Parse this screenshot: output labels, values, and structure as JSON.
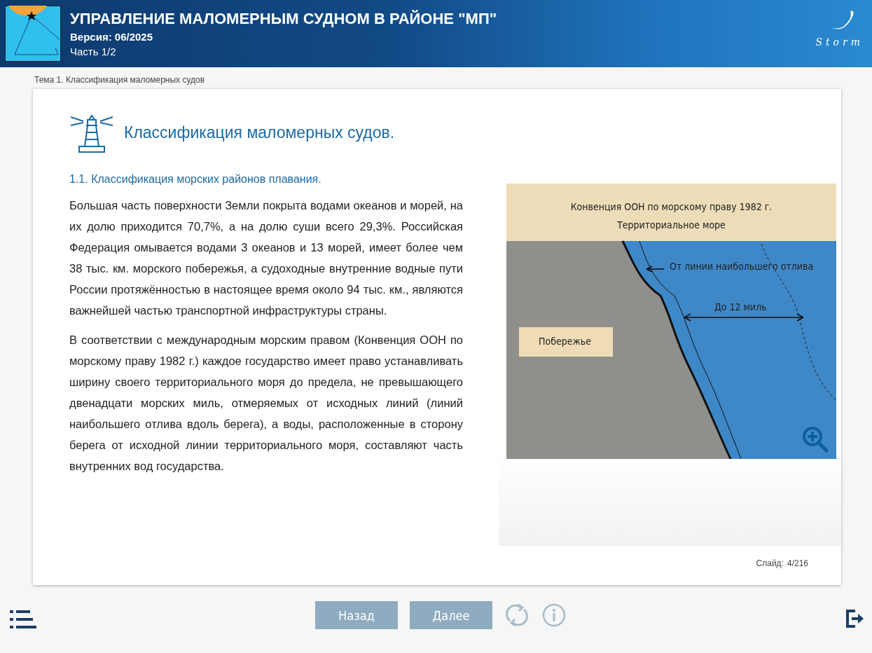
{
  "header": {
    "title": "УПРАВЛЕНИЕ МАЛОМЕРНЫМ СУДНОМ В РАЙОНЕ \"МП\"",
    "version": "Версия: 06/2025",
    "part": "Часть 1/2",
    "brand": "Storm"
  },
  "breadcrumb": "Тема 1. Классификация маломерных судов",
  "slide": {
    "heading": "Классификация маломерных судов.",
    "subheading": "1.1. Классификация морских районов плавания.",
    "paragraphs": [
      "Большая часть поверхности Земли покрыта водами океанов и морей, на их долю приходится 70,7%, а на долю суши всего 29,3%. Российская Федерация омывается водами 3 океанов и 13 морей, имеет более чем 38 тыс. км. морского побережья, а судоходные внутренние водные пути России протяжённостью в настоящее время около 94 тыс. км., являются важнейшей частью транспортной инфраструктуры страны.",
      "В соответствии с международным морским правом (Конвенция ООН по морскому праву 1982 г.) каждое государство имеет право устанавливать ширину своего территориального моря до предела, не превышающего двенадцати морских миль, отмеряемых от исходных линий (линий наибольшего отлива вдоль берега), а воды, расположенные в сторону берега от исходной линии территориального моря, составляют часть внутренних вод государства."
    ],
    "diagram": {
      "title_lines": [
        "Конвенция ООН по морскому праву 1982 г.",
        "Территориальное море"
      ],
      "baseline_label": "От линии наибольшего отлива",
      "distance_label": "До 12 миль",
      "land_label": "Побережье"
    },
    "counter_label": "Слайд:",
    "counter_value": "4/216"
  },
  "footer": {
    "buttons": [
      "Назад",
      "Далее"
    ]
  }
}
